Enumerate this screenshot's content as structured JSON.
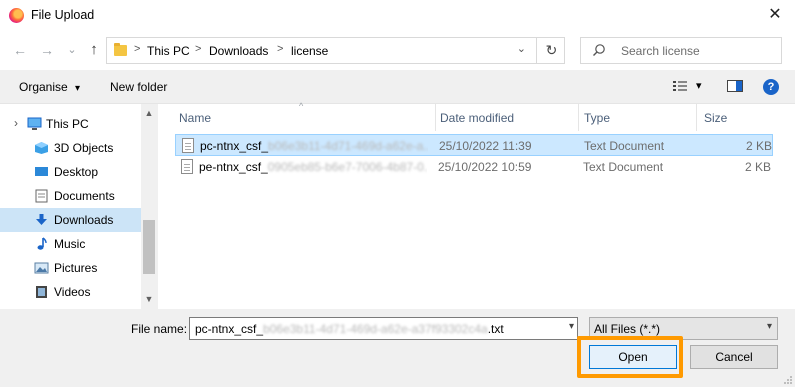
{
  "window": {
    "title": "File Upload",
    "close_glyph": "✕",
    "app_icon": "firefox-icon"
  },
  "navigation": {
    "back_glyph": "←",
    "forward_glyph": "→",
    "recent_glyph": "⌄",
    "up_glyph": "↑",
    "breadcrumb": [
      "This PC",
      "Downloads",
      "license"
    ],
    "separator": ">",
    "refresh_glyph": "↻",
    "search_placeholder": "Search license"
  },
  "toolbar": {
    "organise_label": "Organise",
    "new_folder_label": "New folder",
    "dropdown_glyph": "▾",
    "help_glyph": "?"
  },
  "sidebar": {
    "items": [
      {
        "label": "This PC",
        "icon": "computer-icon"
      },
      {
        "label": "3D Objects",
        "icon": "cube-icon"
      },
      {
        "label": "Desktop",
        "icon": "desktop-icon"
      },
      {
        "label": "Documents",
        "icon": "documents-icon"
      },
      {
        "label": "Downloads",
        "icon": "download-icon",
        "active": true
      },
      {
        "label": "Music",
        "icon": "music-note-icon"
      },
      {
        "label": "Pictures",
        "icon": "pictures-icon"
      },
      {
        "label": "Videos",
        "icon": "videos-icon"
      }
    ],
    "expander_glyph": "›",
    "scroll_up_glyph": "▲",
    "scroll_down_glyph": "▼"
  },
  "file_list": {
    "sort_glyph": "^",
    "columns": [
      "Name",
      "Date modified",
      "Type",
      "Size"
    ],
    "rows": [
      {
        "name_visible": "pc-ntnx_csf_",
        "name_blurred": "b06e3b11-4d71-469d-a62e-a...",
        "date": "25/10/2022 11:39",
        "type": "Text Document",
        "size": "2 KB",
        "selected": true
      },
      {
        "name_visible": "pe-ntnx_csf_",
        "name_blurred": "0905eb85-b6e7-7006-4b87-0...",
        "date": "25/10/2022 10:59",
        "type": "Text Document",
        "size": "2 KB",
        "selected": false
      }
    ]
  },
  "footer": {
    "file_name_label": "File name:",
    "file_name_prefix": "pc-ntnx_csf_",
    "file_name_blurred": "b06e3b11-4d71-469d-a62e-a37f93302c4a",
    "file_name_suffix": ".txt",
    "file_type": "All Files (*.*)",
    "open_label": "Open",
    "cancel_label": "Cancel",
    "highlight_color": "#ff9a00"
  }
}
